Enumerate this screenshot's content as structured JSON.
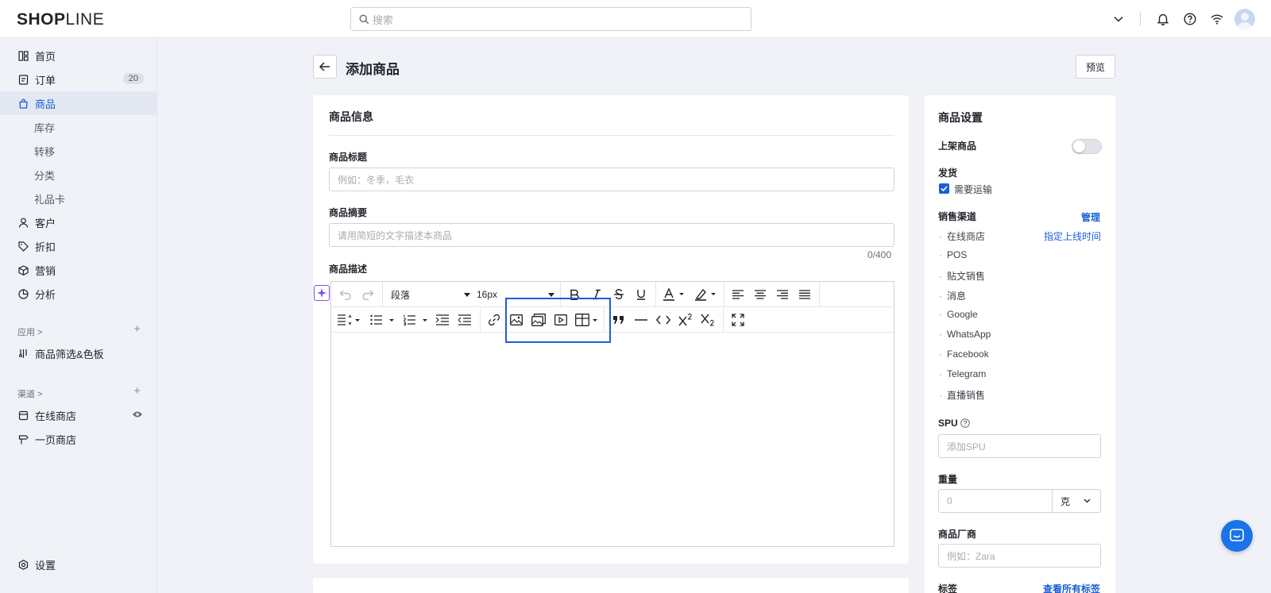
{
  "brand": {
    "logo_bold": "SHOP",
    "logo_light": "LINE"
  },
  "search": {
    "placeholder": "搜索"
  },
  "sidebar": {
    "items": [
      {
        "label": "首页"
      },
      {
        "label": "订单",
        "badge": "20"
      },
      {
        "label": "商品"
      },
      {
        "label": "库存"
      },
      {
        "label": "转移"
      },
      {
        "label": "分类"
      },
      {
        "label": "礼品卡"
      },
      {
        "label": "客户"
      },
      {
        "label": "折扣"
      },
      {
        "label": "营销"
      },
      {
        "label": "分析"
      }
    ],
    "apps_label": "应用 >",
    "app_item": "商品筛选&色板",
    "channels_label": "渠道 >",
    "channel_items": [
      "在线商店",
      "一页商店"
    ],
    "settings": "设置"
  },
  "page": {
    "title": "添加商品",
    "preview": "预览"
  },
  "product_info": {
    "section_title": "商品信息",
    "title_label": "商品标题",
    "title_placeholder": "例如：冬季，毛衣",
    "summary_label": "商品摘要",
    "summary_placeholder": "请用简短的文字描述本商品",
    "summary_counter": "0/400",
    "desc_label": "商品描述"
  },
  "editor": {
    "paragraph": "段落",
    "font_size": "16px"
  },
  "settings_panel": {
    "title": "商品设置",
    "publish_label": "上架商品",
    "publish_on": false,
    "shipping_label": "发货",
    "shipping_checkbox": "需要运输",
    "shipping_checked": true,
    "channels_label": "销售渠道",
    "manage_link": "管理",
    "schedule_link": "指定上线时间",
    "channels": [
      "在线商店",
      "POS",
      "贴文销售",
      "消息",
      "Google",
      "WhatsApp",
      "Facebook",
      "Telegram",
      "直播销售"
    ],
    "spu_label": "SPU",
    "spu_placeholder": "添加SPU",
    "weight_label": "重量",
    "weight_placeholder": "0",
    "weight_unit": "克",
    "vendor_label": "商品厂商",
    "vendor_placeholder": "例如：Zara",
    "tags_label": "标签",
    "tags_link": "查看所有标签"
  }
}
